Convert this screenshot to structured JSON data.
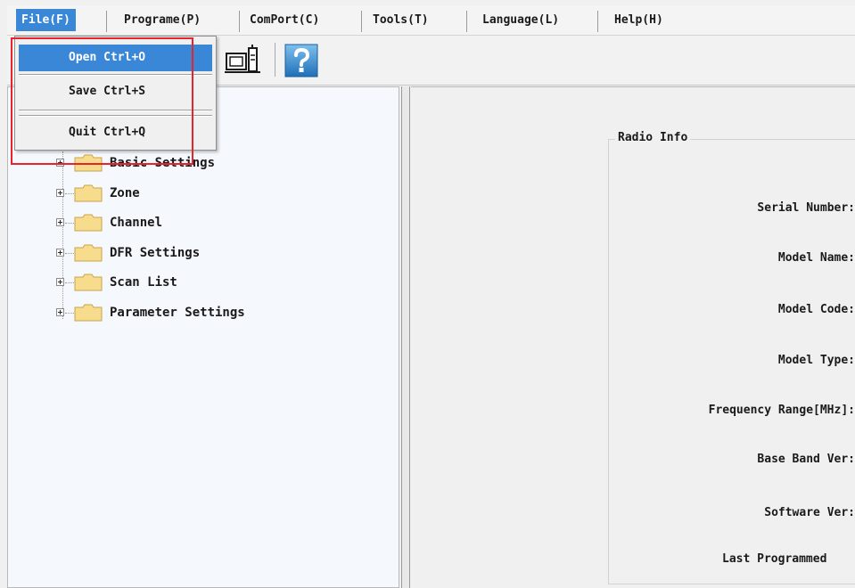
{
  "menu": {
    "file": "File(F)",
    "programe": "Programe(P)",
    "comport": "ComPort(C)",
    "tools": "Tools(T)",
    "language": "Language(L)",
    "help": "Help(H)"
  },
  "file_menu": {
    "open": "Open  Ctrl+O",
    "save": "Save  Ctrl+S",
    "quit": "Quit  Ctrl+Q"
  },
  "toolbar": {
    "icons": [
      "read-radio-icon",
      "help-icon"
    ]
  },
  "tree": {
    "items": [
      "Basic Settings",
      "Zone",
      "Channel",
      "DFR Settings",
      "Scan List",
      "Parameter Settings"
    ]
  },
  "radio_info": {
    "title": "Radio Info",
    "fields": [
      "Serial Number:",
      "Model Name:",
      "Model Code:",
      "Model Type:",
      "Frequency Range[MHz]:",
      "Base Band Ver:",
      "Software Ver:",
      "Last Programmed"
    ]
  },
  "colors": {
    "selection": "#3a87d8",
    "annotation_box": "#e8242a"
  }
}
